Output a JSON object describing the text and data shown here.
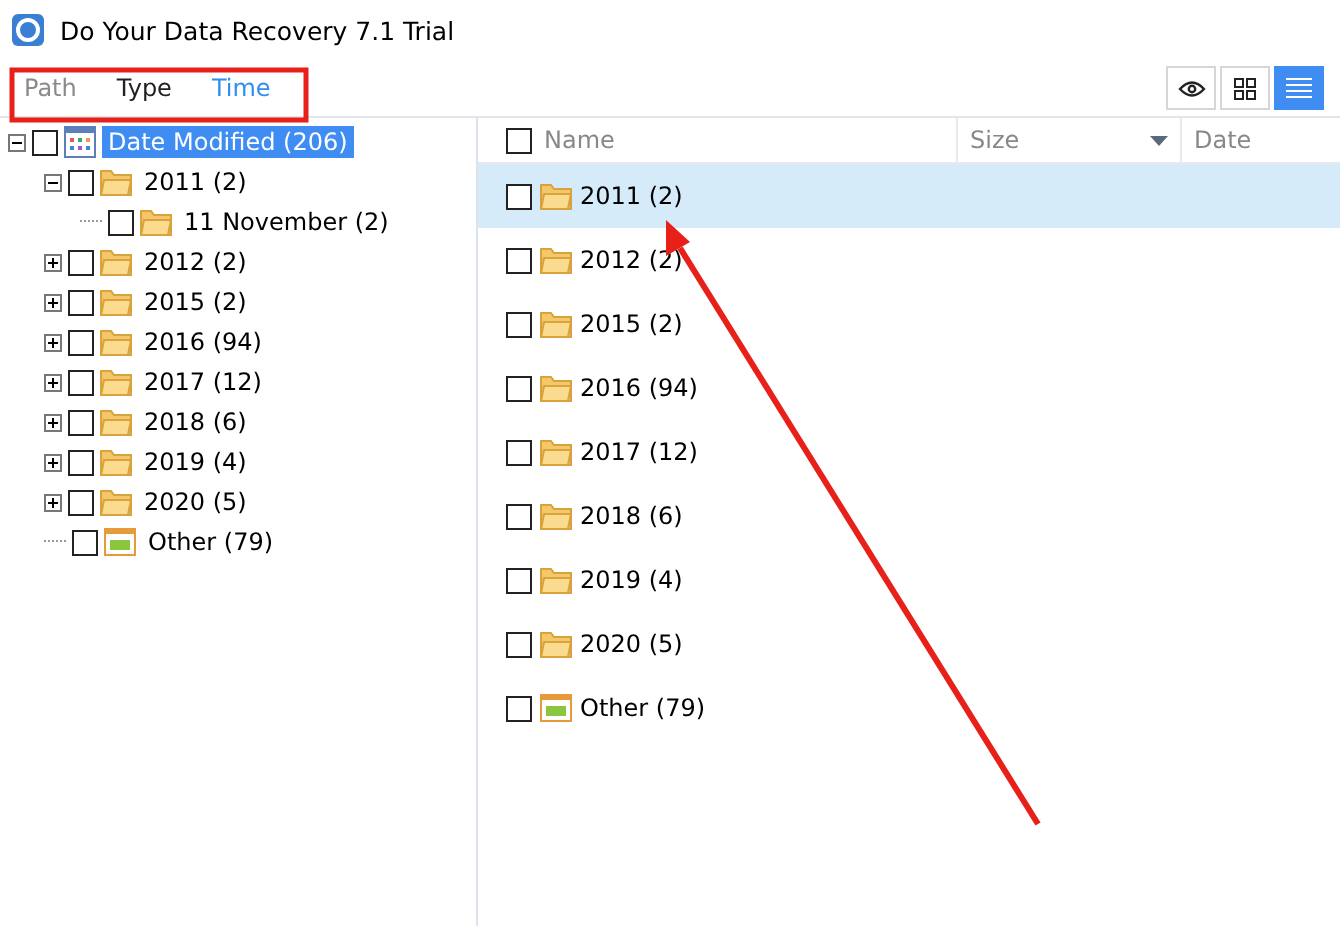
{
  "window": {
    "title": "Do Your Data Recovery 7.1 Trial"
  },
  "tabs": [
    {
      "label": "Path",
      "selected": false,
      "disabled": true
    },
    {
      "label": "Type",
      "selected": false,
      "disabled": false
    },
    {
      "label": "Time",
      "selected": true,
      "disabled": false
    }
  ],
  "view_buttons": [
    {
      "kind": "preview",
      "selected": false
    },
    {
      "kind": "grid",
      "selected": false
    },
    {
      "kind": "list",
      "selected": true
    }
  ],
  "tree": [
    {
      "label": "Date Modified (206)",
      "kind": "calendar",
      "expanded": true,
      "checked": false,
      "selected": true,
      "children": [
        {
          "label": "2011 (2)",
          "kind": "folder",
          "expanded": true,
          "checked": false,
          "selected": false,
          "children": [
            {
              "label": "11 November (2)",
              "kind": "folder",
              "checked": false,
              "selected": false
            }
          ]
        },
        {
          "label": "2012 (2)",
          "kind": "folder",
          "expanded": false,
          "checked": false,
          "selected": false
        },
        {
          "label": "2015 (2)",
          "kind": "folder",
          "expanded": false,
          "checked": false,
          "selected": false
        },
        {
          "label": "2016 (94)",
          "kind": "folder",
          "expanded": false,
          "checked": false,
          "selected": false
        },
        {
          "label": "2017 (12)",
          "kind": "folder",
          "expanded": false,
          "checked": false,
          "selected": false
        },
        {
          "label": "2018 (6)",
          "kind": "folder",
          "expanded": false,
          "checked": false,
          "selected": false
        },
        {
          "label": "2019 (4)",
          "kind": "folder",
          "expanded": false,
          "checked": false,
          "selected": false
        },
        {
          "label": "2020 (5)",
          "kind": "folder",
          "expanded": false,
          "checked": false,
          "selected": false
        },
        {
          "label": "Other (79)",
          "kind": "other",
          "checked": false,
          "selected": false
        }
      ]
    }
  ],
  "table": {
    "select_all_checked": false,
    "columns": [
      "Name",
      "Size",
      "Date"
    ],
    "rows": [
      {
        "name": "2011 (2)",
        "kind": "folder",
        "checked": false,
        "selected": true
      },
      {
        "name": "2012 (2)",
        "kind": "folder",
        "checked": false,
        "selected": false
      },
      {
        "name": "2015 (2)",
        "kind": "folder",
        "checked": false,
        "selected": false
      },
      {
        "name": "2016 (94)",
        "kind": "folder",
        "checked": false,
        "selected": false
      },
      {
        "name": "2017 (12)",
        "kind": "folder",
        "checked": false,
        "selected": false
      },
      {
        "name": "2018 (6)",
        "kind": "folder",
        "checked": false,
        "selected": false
      },
      {
        "name": "2019 (4)",
        "kind": "folder",
        "checked": false,
        "selected": false
      },
      {
        "name": "2020 (5)",
        "kind": "folder",
        "checked": false,
        "selected": false
      },
      {
        "name": "Other (79)",
        "kind": "other",
        "checked": false,
        "selected": false
      }
    ]
  }
}
